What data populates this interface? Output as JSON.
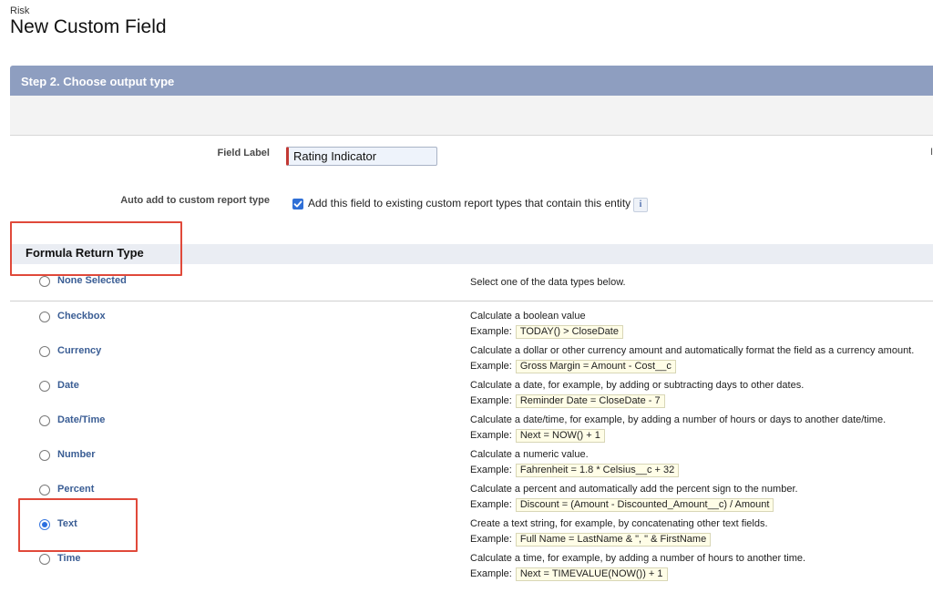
{
  "header": {
    "breadcrumb": "Risk",
    "title": "New Custom Field"
  },
  "step": {
    "title": "Step 2. Choose output type"
  },
  "form": {
    "field_label": {
      "label": "Field Label",
      "value": "Rating Indicator"
    },
    "edge_char": "I",
    "auto_add": {
      "label": "Auto add to custom report type",
      "checked": true,
      "text": "Add this field to existing custom report types that contain this entity",
      "info_icon": "i"
    }
  },
  "return_type": {
    "section_title": "Formula Return Type",
    "example_label": "Example:",
    "options": [
      {
        "label": "None Selected",
        "selected": false,
        "description": "Select one of the data types below.",
        "example": ""
      },
      {
        "label": "Checkbox",
        "selected": false,
        "description": "Calculate a boolean value",
        "example": "TODAY() > CloseDate"
      },
      {
        "label": "Currency",
        "selected": false,
        "description": "Calculate a dollar or other currency amount and automatically format the field as a currency amount.",
        "example": "Gross Margin = Amount - Cost__c"
      },
      {
        "label": "Date",
        "selected": false,
        "description": "Calculate a date, for example, by adding or subtracting days to other dates.",
        "example": "Reminder Date = CloseDate - 7"
      },
      {
        "label": "Date/Time",
        "selected": false,
        "description": "Calculate a date/time, for example, by adding a number of hours or days to another date/time.",
        "example": "Next = NOW() + 1"
      },
      {
        "label": "Number",
        "selected": false,
        "description": "Calculate a numeric value.",
        "example": "Fahrenheit = 1.8 * Celsius__c + 32"
      },
      {
        "label": "Percent",
        "selected": false,
        "description": "Calculate a percent and automatically add the percent sign to the number.",
        "example": "Discount = (Amount - Discounted_Amount__c) / Amount"
      },
      {
        "label": "Text",
        "selected": true,
        "description": "Create a text string, for example, by concatenating other text fields.",
        "example": "Full Name = LastName & \", \" & FirstName"
      },
      {
        "label": "Time",
        "selected": false,
        "description": "Calculate a time, for example, by adding a number of hours to another time.",
        "example": "Next = TIMEVALUE(NOW()) + 1"
      }
    ]
  },
  "colors": {
    "step_header": "#8e9ec0",
    "highlight": "#e0493a",
    "required_bar": "#c23934",
    "radio_selected": "#2b6fe0",
    "type_label": "#3a5d94"
  }
}
